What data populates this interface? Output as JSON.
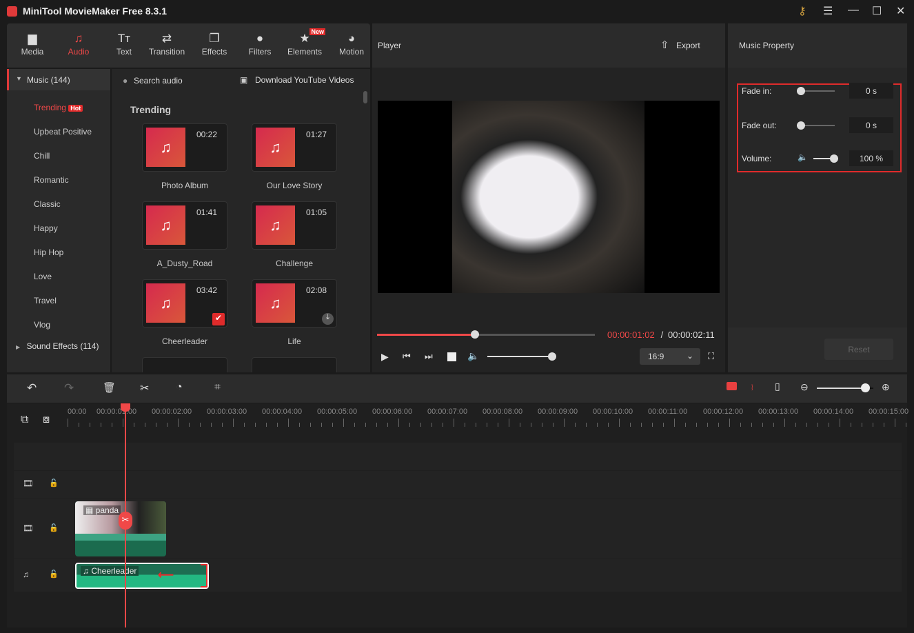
{
  "app": {
    "title": "MiniTool MovieMaker Free 8.3.1"
  },
  "toolbar": [
    {
      "label": "Media",
      "icon": "folder-icon"
    },
    {
      "label": "Audio",
      "icon": "music-icon",
      "active": true
    },
    {
      "label": "Text",
      "icon": "text-icon"
    },
    {
      "label": "Transition",
      "icon": "transition-icon"
    },
    {
      "label": "Effects",
      "icon": "effects-icon"
    },
    {
      "label": "Filters",
      "icon": "filters-icon"
    },
    {
      "label": "Elements",
      "icon": "elements-icon",
      "badge": "New"
    },
    {
      "label": "Motion",
      "icon": "motion-icon"
    }
  ],
  "sidebar": {
    "music": "Music (144)",
    "items": [
      "Trending",
      "Upbeat Positive",
      "Chill",
      "Romantic",
      "Classic",
      "Happy",
      "Hip Hop",
      "Love",
      "Travel",
      "Vlog"
    ],
    "hot": "Hot",
    "sound_effects": "Sound Effects (114)"
  },
  "library": {
    "search": "Search audio",
    "download": "Download YouTube Videos",
    "heading": "Trending",
    "items": [
      {
        "name": "Photo Album",
        "duration": "00:22"
      },
      {
        "name": "Our Love Story",
        "duration": "01:27"
      },
      {
        "name": "A_Dusty_Road",
        "duration": "01:41"
      },
      {
        "name": "Challenge",
        "duration": "01:05"
      },
      {
        "name": "Cheerleader",
        "duration": "03:42",
        "status": "added"
      },
      {
        "name": "Life",
        "duration": "02:08",
        "status": "download"
      }
    ]
  },
  "player": {
    "title": "Player",
    "export": "Export",
    "current": "00:00:01:02",
    "separator": " / ",
    "total": "00:00:02:11",
    "progress": 0.45,
    "volume": 1.0,
    "aspect": "16:9"
  },
  "music_property": {
    "title": "Music Property",
    "fade_in_label": "Fade in:",
    "fade_in": "0 s",
    "fade_out_label": "Fade out:",
    "fade_out": "0 s",
    "volume_label": "Volume:",
    "volume": "100 %",
    "reset": "Reset"
  },
  "timeline": {
    "ruler": [
      "00:00",
      "00:00:01:00",
      "00:00:02:00",
      "00:00:03:00",
      "00:00:04:00",
      "00:00:05:00",
      "00:00:06:00",
      "00:00:07:00",
      "00:00:08:00",
      "00:00:09:00",
      "00:00:10:00",
      "00:00:11:00",
      "00:00:12:00",
      "00:00:13:00",
      "00:00:14:00",
      "00:00:15:00"
    ],
    "video_clip": "panda",
    "audio_clip": "Cheerleader",
    "zoom": 0.85
  }
}
